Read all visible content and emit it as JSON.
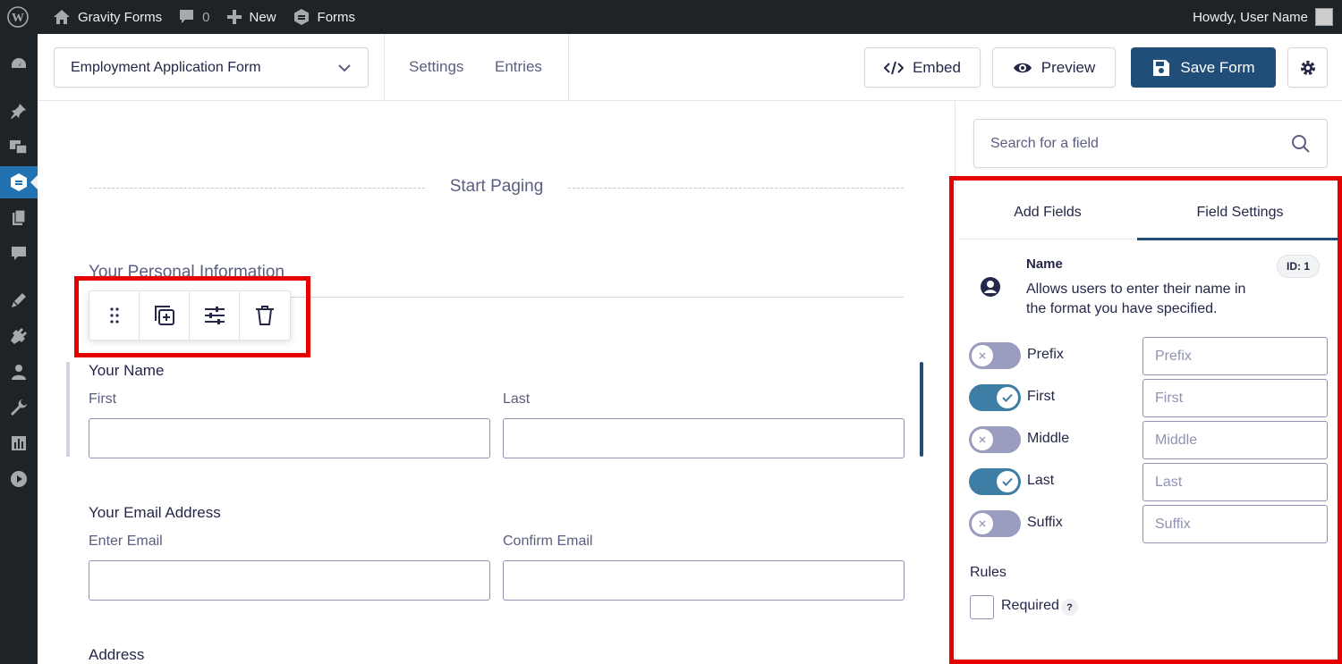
{
  "adminbar": {
    "site_name": "Gravity Forms",
    "comments_count": "0",
    "new_label": "New",
    "forms_label": "Forms",
    "howdy": "Howdy, User Name"
  },
  "admin_menu": {
    "icons": [
      "dashboard-icon",
      "pin-icon",
      "media-icon",
      "gravity-forms-icon",
      "pages-icon",
      "comments-icon",
      "appearance-icon",
      "plugins-icon",
      "users-icon",
      "tools-icon",
      "settings-icon",
      "play-icon"
    ],
    "active": "gravity-forms-icon"
  },
  "header": {
    "form_name": "Employment Application Form",
    "settings_label": "Settings",
    "entries_label": "Entries",
    "embed_label": "Embed",
    "preview_label": "Preview",
    "save_label": "Save Form"
  },
  "canvas": {
    "page_break_label": "Start Paging",
    "section_title": "Your Personal Information",
    "name_field": {
      "label": "Your Name",
      "first": "First",
      "last": "Last"
    },
    "email_field": {
      "label": "Your Email Address",
      "enter": "Enter Email",
      "confirm": "Confirm Email"
    },
    "address_label": "Address"
  },
  "sidebar": {
    "search_placeholder": "Search for a field",
    "tabs": [
      {
        "label": "Add Fields",
        "active": false
      },
      {
        "label": "Field Settings",
        "active": true
      }
    ],
    "field": {
      "title": "Name",
      "id_badge": "ID: 1",
      "description": "Allows users to enter their name in the format you have specified."
    },
    "name_parts": [
      {
        "label": "Prefix",
        "enabled": false,
        "placeholder": "Prefix"
      },
      {
        "label": "First",
        "enabled": true,
        "placeholder": "First"
      },
      {
        "label": "Middle",
        "enabled": false,
        "placeholder": "Middle"
      },
      {
        "label": "Last",
        "enabled": true,
        "placeholder": "Last"
      },
      {
        "label": "Suffix",
        "enabled": false,
        "placeholder": "Suffix"
      }
    ],
    "rules_label": "Rules",
    "required_label": "Required",
    "help_mark": "?"
  },
  "colors": {
    "admin_bar": "#1d2327",
    "primary": "#204e79",
    "toggle_on": "#3e7da6",
    "toggle_off": "#9a9cc0",
    "highlight": "#e60000"
  }
}
